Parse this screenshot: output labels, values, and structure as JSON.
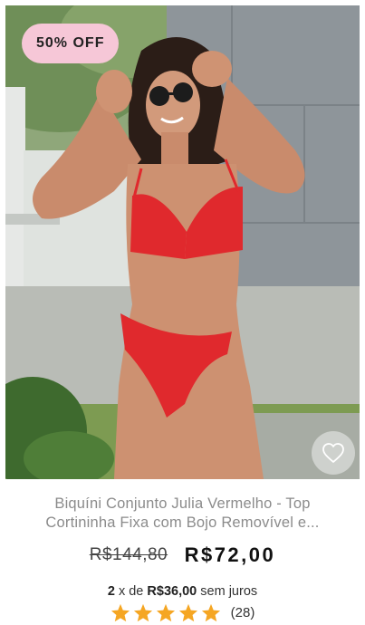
{
  "product": {
    "badge": "50% OFF",
    "title": "Biquíni Conjunto Julia Vermelho - Top Cortininha Fixa com Bojo Removível e...",
    "old_price": "R$144,80",
    "price": "R$72,00",
    "installments": {
      "count": "2",
      "separator": "x de",
      "amount": "R$36,00",
      "suffix": "sem juros"
    },
    "rating": {
      "stars": 5,
      "max_stars": 5,
      "count_label": "(28)"
    },
    "image_alt": "product-photo",
    "favorite_icon": "heart-outline-icon"
  },
  "colors": {
    "badge_bg": "#f6c7d7",
    "star": "#f5a623",
    "title": "#8b8b8b",
    "swimsuit": "#e0292d"
  }
}
